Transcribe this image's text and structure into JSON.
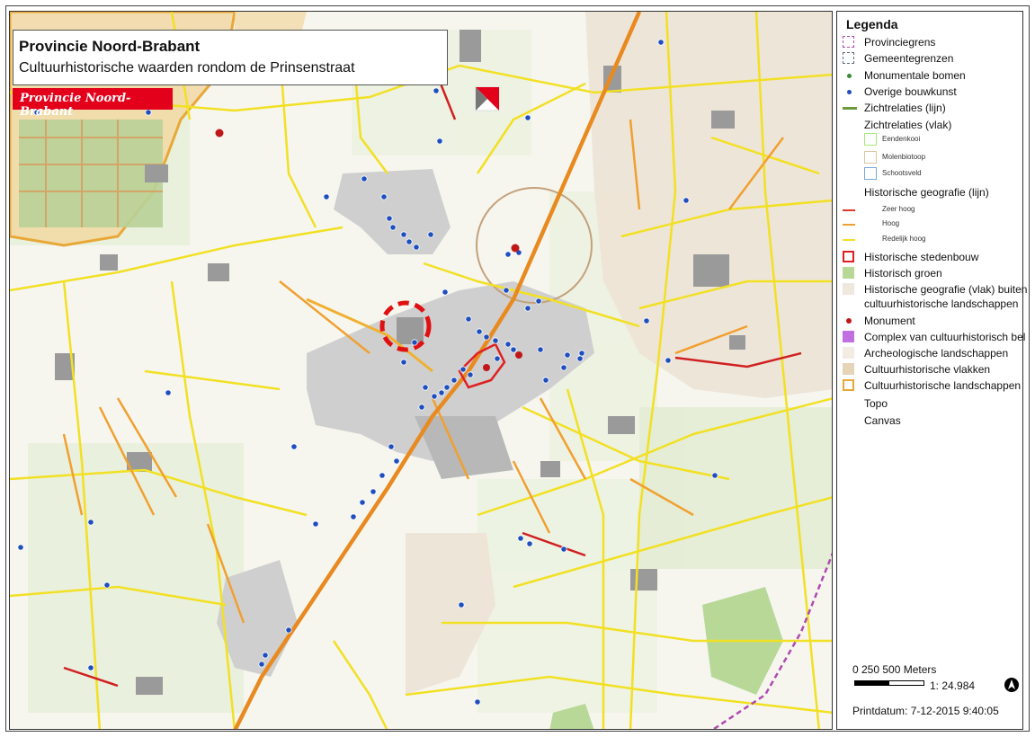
{
  "title": "Provincie Noord-Brabant",
  "subtitle": "Cultuurhistorische waarden rondom de Prinsenstraat",
  "logo_text": "Provincie Noord-Brabant",
  "legend": {
    "heading": "Legenda",
    "items": [
      {
        "label": "Provinciegrens",
        "symbol": "dashed-box",
        "color": "#b04ab0"
      },
      {
        "label": "Gemeentegrenzen",
        "symbol": "dashed-box",
        "color": "#5a6a7a"
      },
      {
        "label": "Monumentale bomen",
        "symbol": "dot",
        "color": "#3a8a3a"
      },
      {
        "label": "Overige bouwkunst",
        "symbol": "dot",
        "color": "#1f4fbf"
      },
      {
        "label": "Zichtrelaties (lijn)",
        "symbol": "arrow",
        "color": "#6a9a3a"
      },
      {
        "label": "Zichtrelaties (vlak)",
        "symbol": "none",
        "color": ""
      },
      {
        "label": "Eendenkooi",
        "symbol": "box-sub",
        "color": "#a8e878"
      },
      {
        "label": "Molenbiotoop",
        "symbol": "box-sub",
        "color": "#d8c8a0"
      },
      {
        "label": "Schootsveld",
        "symbol": "box-sub",
        "color": "#7aa8d8"
      },
      {
        "label": "Historische geografie (lijn)",
        "symbol": "none",
        "color": ""
      },
      {
        "label": "Zeer hoog",
        "symbol": "line-sub",
        "color": "#e03a2a"
      },
      {
        "label": "Hoog",
        "symbol": "line-sub",
        "color": "#f0a030"
      },
      {
        "label": "Redelijk hoog",
        "symbol": "line-sub",
        "color": "#f2e020"
      },
      {
        "label": "Historische stedenbouw",
        "symbol": "outline-box",
        "color": "#e02020"
      },
      {
        "label": "Historisch groen",
        "symbol": "fill-box",
        "color": "#b8d898"
      },
      {
        "label": "Historische geografie (vlak) buiten",
        "symbol": "fill-box",
        "color": "#efe8dc"
      },
      {
        "label": "cultuurhistorische landschappen",
        "symbol": "none",
        "color": ""
      },
      {
        "label": "Monument",
        "symbol": "red-dot",
        "color": "#c01818"
      },
      {
        "label": "Complex van cultuurhistorisch bel",
        "symbol": "fill-box",
        "color": "#c070e0"
      },
      {
        "label": "Archeologische landschappen",
        "symbol": "fill-box",
        "color": "#f3ece2"
      },
      {
        "label": "Cultuurhistorische vlakken",
        "symbol": "fill-box",
        "color": "#e6d4b8"
      },
      {
        "label": "Cultuurhistorische landschappen",
        "symbol": "outline-box",
        "color": "#e8a838"
      },
      {
        "label": "Topo",
        "symbol": "none",
        "color": ""
      },
      {
        "label": "Canvas",
        "symbol": "none",
        "color": ""
      }
    ]
  },
  "scale": {
    "labels": "0     250    500    Meters",
    "ratio": "1: 24.984",
    "print_date": "Printdatum: 7-12-2015 9:40:05"
  },
  "colors": {
    "road_major": "#f0b030",
    "road_minor": "#f2e024",
    "urban": "#c9c9c9",
    "hist_line_high": "#e88a20",
    "hist_line_very_high": "#d02020",
    "bouwkunst": "#1f4fbf",
    "monument": "#c01818"
  }
}
